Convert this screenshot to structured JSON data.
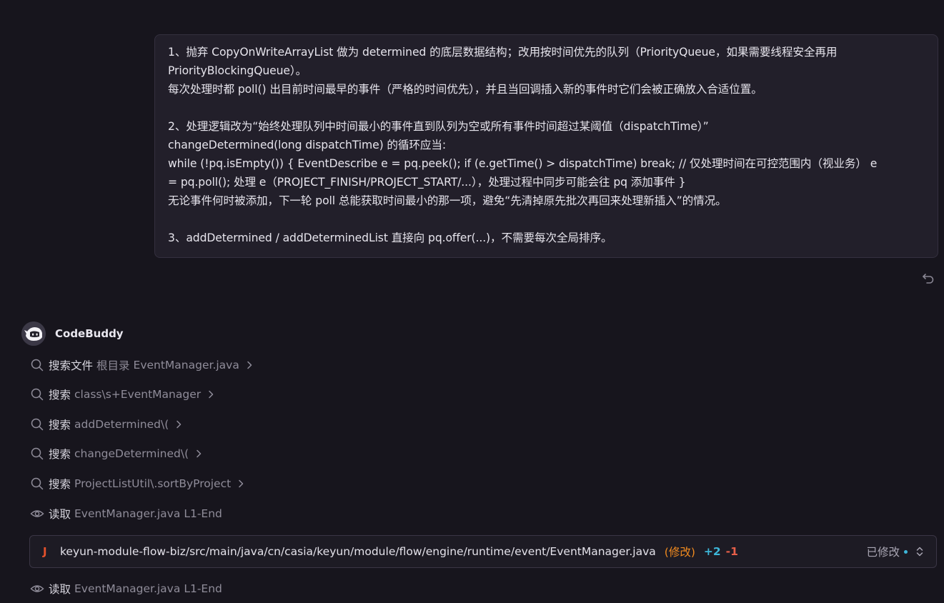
{
  "user_message": {
    "lines": [
      "1、抛弃 CopyOnWriteArrayList 做为 determined 的底层数据结构；改用按时间优先的队列（PriorityQueue，如果需要线程安全再用",
      "PriorityBlockingQueue）。",
      "每次处理时都 poll() 出目前时间最早的事件（严格的时间优先），并且当回调插入新的事件时它们会被正确放入合适位置。",
      "",
      "2、处理逻辑改为“始终处理队列中时间最小的事件直到队列为空或所有事件时间超过某阈值（dispatchTime）”",
      "changeDetermined(long dispatchTime) 的循环应当:",
      "while (!pq.isEmpty()) { EventDescribe e = pq.peek(); if (e.getTime() > dispatchTime) break; // 仅处理时间在可控范围内（视业务） e",
      "= pq.poll(); 处理 e（PROJECT_FINISH/PROJECT_START/...），处理过程中同步可能会往 pq 添加事件 }",
      "无论事件何时被添加，下一轮 poll 总能获取时间最小的那一项，避免“先清掉原先批次再回来处理新插入”的情况。",
      "",
      "3、addDetermined / addDeterminedList 直接向 pq.offer(...)，不需要每次全局排序。"
    ]
  },
  "assistant": {
    "name": "CodeBuddy"
  },
  "tool_calls": [
    {
      "icon": "search-icon",
      "verb": "搜索文件",
      "arg": "根目录",
      "arg2": "EventManager.java",
      "expandable": true
    },
    {
      "icon": "search-icon",
      "verb": "搜索",
      "arg": "class\\s+EventManager",
      "arg2": "",
      "expandable": true
    },
    {
      "icon": "search-icon",
      "verb": "搜索",
      "arg": "addDetermined\\(",
      "arg2": "",
      "expandable": true
    },
    {
      "icon": "search-icon",
      "verb": "搜索",
      "arg": "changeDetermined\\(",
      "arg2": "",
      "expandable": true
    },
    {
      "icon": "search-icon",
      "verb": "搜索",
      "arg": "ProjectListUtil\\.sortByProject",
      "arg2": "",
      "expandable": true
    },
    {
      "icon": "eye-icon",
      "verb": "读取",
      "arg": "EventManager.java",
      "arg2": "L1-End",
      "expandable": false
    }
  ],
  "file_change": {
    "icon": "java-file-icon",
    "icon_glyph": "J",
    "path": "keyun-module-flow-biz/src/main/java/cn/casia/keyun/module/flow/engine/runtime/event/EventManager.java",
    "status": "(修改)",
    "additions": "+2",
    "deletions": "-1",
    "state_label": "已修改"
  },
  "last_tool_call": {
    "icon": "eye-icon",
    "verb": "读取",
    "arg": "EventManager.java",
    "arg2": "L1-End"
  },
  "colors": {
    "background": "#17151d",
    "bubble": "#221f2a",
    "accent_blue": "#3db6d8",
    "accent_orange": "#f08a1f",
    "accent_red": "#e65f49",
    "java_red": "#e5512c"
  }
}
